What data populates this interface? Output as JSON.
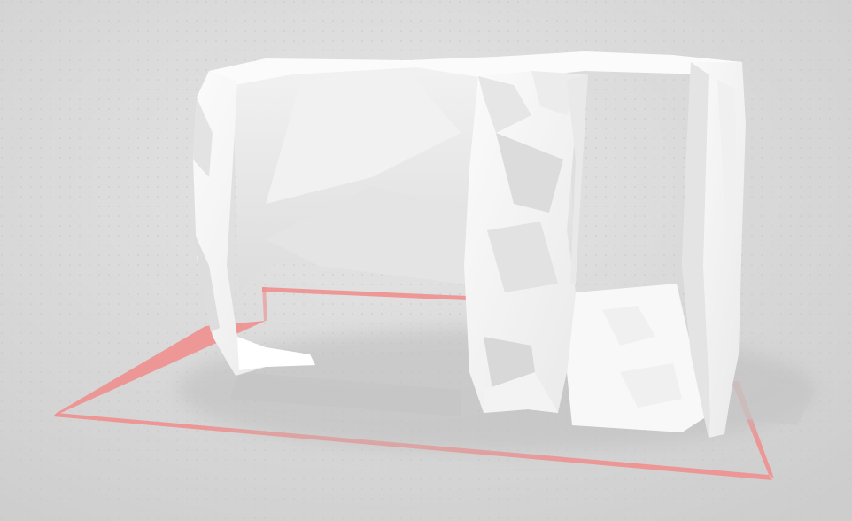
{
  "viewport": {
    "background_color": "#d6d6d6",
    "grid_dot_color": "#c7c7c7"
  },
  "build_plate": {
    "outline_color": "#ef8f8f"
  },
  "model": {
    "surface_color": "#f7f7f7",
    "shade_color": "#dedede",
    "shadow_color": "#bdbdbd"
  }
}
